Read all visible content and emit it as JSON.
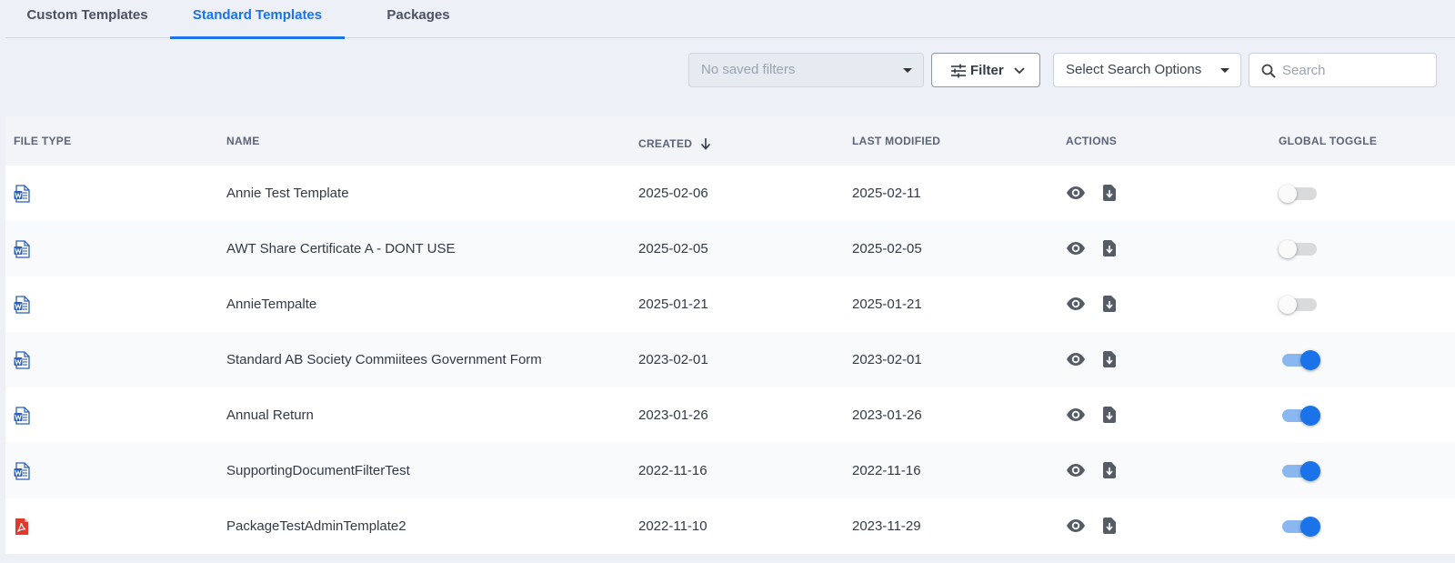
{
  "tabs": [
    {
      "label": "Custom Templates",
      "active": false
    },
    {
      "label": "Standard Templates",
      "active": true
    },
    {
      "label": "Packages",
      "active": false
    }
  ],
  "toolbar": {
    "saved_filters_placeholder": "No saved filters",
    "filter_label": "Filter",
    "search_options_label": "Select Search Options",
    "search_placeholder": "Search"
  },
  "table": {
    "columns": {
      "file_type": "FILE TYPE",
      "name": "NAME",
      "created": "CREATED",
      "last_modified": "LAST MODIFIED",
      "actions": "ACTIONS",
      "global_toggle": "GLOBAL TOGGLE"
    },
    "sort": {
      "column": "created",
      "direction": "desc"
    },
    "rows": [
      {
        "file_type": "word-doc-icon",
        "name": "Annie Test Template",
        "created": "2025-02-06",
        "last_modified": "2025-02-11",
        "global_toggle": false
      },
      {
        "file_type": "word-doc-icon",
        "name": "AWT Share Certificate A - DONT USE",
        "created": "2025-02-05",
        "last_modified": "2025-02-05",
        "global_toggle": false
      },
      {
        "file_type": "word-doc-icon",
        "name": "AnnieTempalte",
        "created": "2025-01-21",
        "last_modified": "2025-01-21",
        "global_toggle": false
      },
      {
        "file_type": "word-doc-icon",
        "name": "Standard AB Society Commiitees Government Form",
        "created": "2023-02-01",
        "last_modified": "2023-02-01",
        "global_toggle": true
      },
      {
        "file_type": "word-doc-icon",
        "name": "Annual Return",
        "created": "2023-01-26",
        "last_modified": "2023-01-26",
        "global_toggle": true
      },
      {
        "file_type": "word-doc-icon",
        "name": "SupportingDocumentFilterTest",
        "created": "2022-11-16",
        "last_modified": "2022-11-16",
        "global_toggle": true
      },
      {
        "file_type": "pdf-icon",
        "name": "PackageTestAdminTemplate2",
        "created": "2022-11-10",
        "last_modified": "2023-11-29",
        "global_toggle": true
      }
    ]
  },
  "colors": {
    "accent": "#1a73e8",
    "word_icon": "#2b5fb8",
    "pdf_icon": "#e03a2f",
    "page_bg": "#edf1f7"
  }
}
